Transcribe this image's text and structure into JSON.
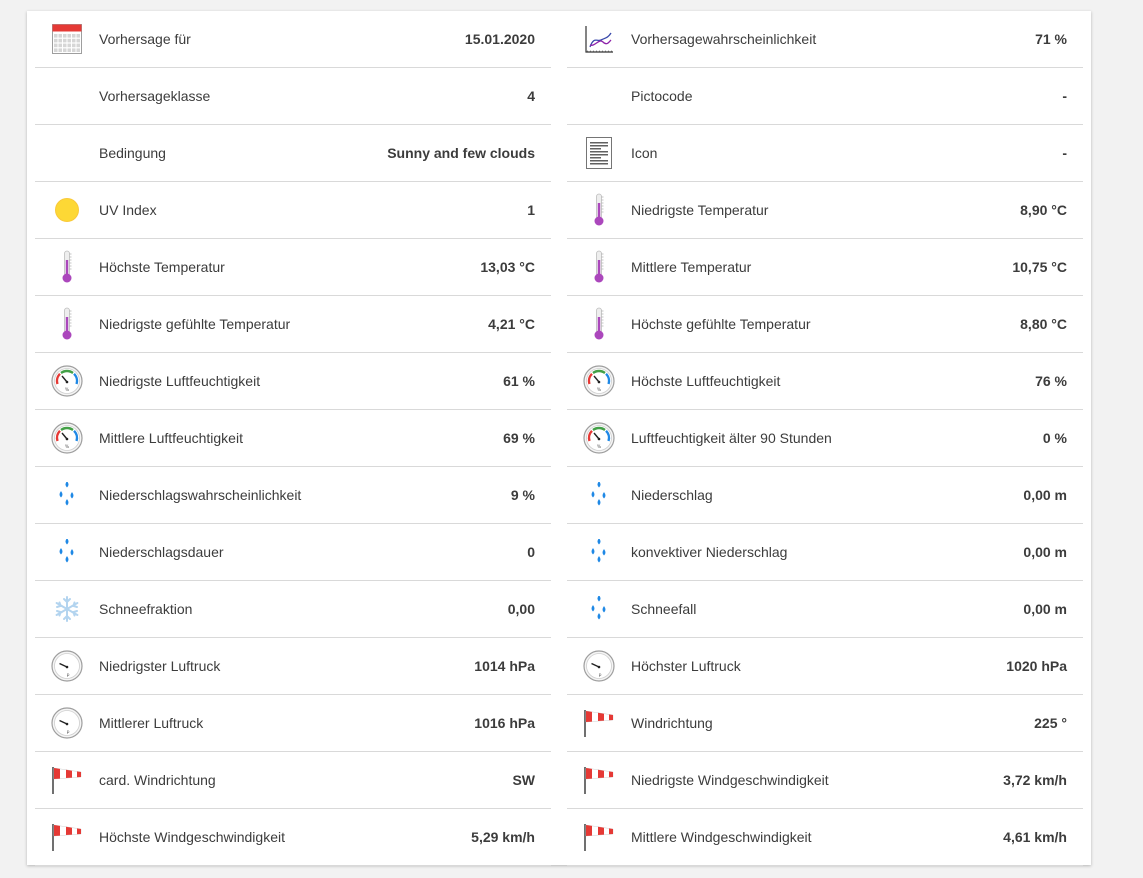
{
  "colors": {
    "calendar_red": "#e53935",
    "thermo_purple": "#ab47bc",
    "sun_yellow": "#fdd835",
    "rain_blue": "#1e88e5",
    "snow_lightblue": "#b3d4ef",
    "windsock_red": "#e53935"
  },
  "left": [
    {
      "icon": "calendar-icon",
      "label": "Vorhersage für",
      "value": "15.01.2020"
    },
    {
      "icon": "",
      "label": "Vorhersageklasse",
      "value": "4"
    },
    {
      "icon": "",
      "label": "Bedingung",
      "value": "Sunny and few clouds"
    },
    {
      "icon": "sun-icon",
      "label": "UV Index",
      "value": "1"
    },
    {
      "icon": "thermometer-icon",
      "label": "Höchste Temperatur",
      "value": "13,03 °C"
    },
    {
      "icon": "thermometer-icon",
      "label": "Niedrigste gefühlte Temperatur",
      "value": "4,21 °C"
    },
    {
      "icon": "hygrometer-icon",
      "label": "Niedrigste Luftfeuchtigkeit",
      "value": "61 %"
    },
    {
      "icon": "hygrometer-icon",
      "label": "Mittlere Luftfeuchtigkeit",
      "value": "69 %"
    },
    {
      "icon": "raindrops-icon",
      "label": "Niederschlagswahrscheinlichkeit",
      "value": "9 %"
    },
    {
      "icon": "raindrops-icon",
      "label": "Niederschlagsdauer",
      "value": "0"
    },
    {
      "icon": "snowflake-icon",
      "label": "Schneefraktion",
      "value": "0,00"
    },
    {
      "icon": "barometer-icon",
      "label": "Niedrigster Luftruck",
      "value": "1014 hPa"
    },
    {
      "icon": "barometer-icon",
      "label": "Mittlerer Luftruck",
      "value": "1016 hPa"
    },
    {
      "icon": "windsock-icon",
      "label": "card. Windrichtung",
      "value": "SW"
    },
    {
      "icon": "windsock-icon",
      "label": "Höchste Windgeschwindigkeit",
      "value": "5,29 km/h"
    }
  ],
  "right": [
    {
      "icon": "chart-icon",
      "label": "Vorhersagewahrscheinlichkeit",
      "value": "71 %"
    },
    {
      "icon": "",
      "label": "Pictocode",
      "value": "-"
    },
    {
      "icon": "document-icon",
      "label": "Icon",
      "value": "-"
    },
    {
      "icon": "thermometer-icon",
      "label": "Niedrigste Temperatur",
      "value": "8,90 °C"
    },
    {
      "icon": "thermometer-icon",
      "label": "Mittlere Temperatur",
      "value": "10,75 °C"
    },
    {
      "icon": "thermometer-icon",
      "label": "Höchste gefühlte Temperatur",
      "value": "8,80 °C"
    },
    {
      "icon": "hygrometer-icon",
      "label": "Höchste Luftfeuchtigkeit",
      "value": "76 %"
    },
    {
      "icon": "hygrometer-icon",
      "label": "Luftfeuchtigkeit älter 90 Stunden",
      "value": "0 %"
    },
    {
      "icon": "raindrops-icon",
      "label": "Niederschlag",
      "value": "0,00 m"
    },
    {
      "icon": "raindrops-icon",
      "label": "konvektiver Niederschlag",
      "value": "0,00 m"
    },
    {
      "icon": "raindrops-icon",
      "label": "Schneefall",
      "value": "0,00 m"
    },
    {
      "icon": "barometer-icon",
      "label": "Höchster Luftruck",
      "value": "1020 hPa"
    },
    {
      "icon": "windsock-icon",
      "label": "Windrichtung",
      "value": "225 °"
    },
    {
      "icon": "windsock-icon",
      "label": "Niedrigste Windgeschwindigkeit",
      "value": "3,72 km/h"
    },
    {
      "icon": "windsock-icon",
      "label": "Mittlere Windgeschwindigkeit",
      "value": "4,61 km/h"
    }
  ]
}
